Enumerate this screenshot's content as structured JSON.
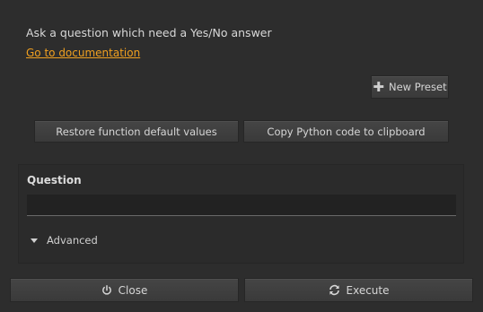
{
  "description": "Ask a question which need a Yes/No answer",
  "doc_link": "Go to documentation",
  "buttons": {
    "new_preset": "New Preset",
    "restore_defaults": "Restore function default values",
    "copy_python": "Copy Python code to clipboard",
    "close": "Close",
    "execute": "Execute"
  },
  "panel": {
    "question_label": "Question",
    "question_value": "",
    "advanced_label": "Advanced"
  },
  "icons": {
    "new_preset": "plus-icon",
    "close": "power-icon",
    "execute": "refresh-icon",
    "advanced": "triangle-down-icon"
  },
  "colors": {
    "background": "#2d2d2d",
    "link": "#f0a020"
  }
}
